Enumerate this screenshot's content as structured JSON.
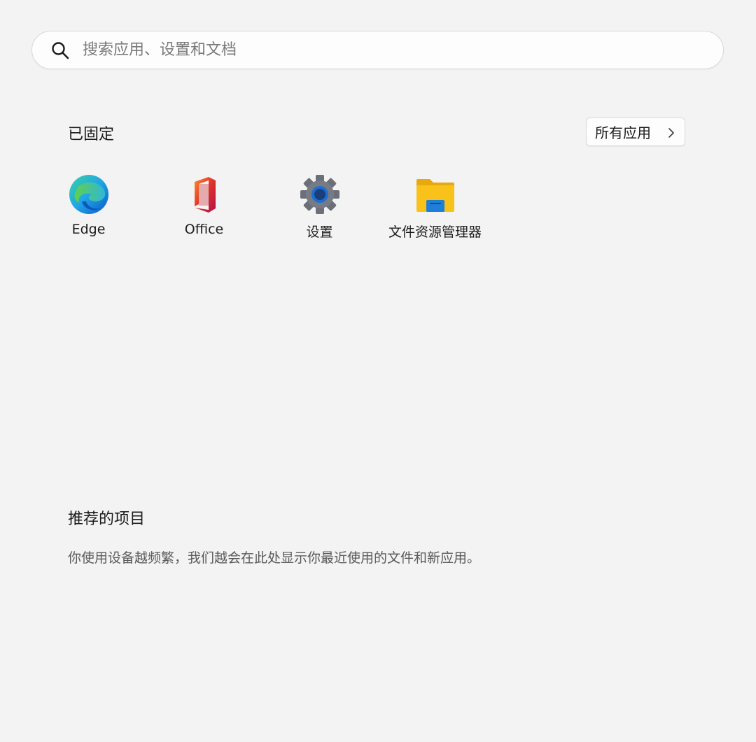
{
  "search": {
    "placeholder": "搜索应用、设置和文档",
    "value": "",
    "icon": "search-icon"
  },
  "pinned": {
    "title": "已固定",
    "all_apps_label": "所有应用",
    "apps": [
      {
        "label": "Edge",
        "icon": "edge-icon"
      },
      {
        "label": "Office",
        "icon": "office-icon"
      },
      {
        "label": "设置",
        "icon": "settings-gear-icon"
      },
      {
        "label": "文件资源管理器",
        "icon": "file-explorer-icon"
      }
    ]
  },
  "recommended": {
    "title": "推荐的项目",
    "hint": "你使用设备越频繁，我们越会在此处显示你最近使用的文件和新应用。"
  },
  "colors": {
    "background": "#f3f3f3",
    "edge_blue": "#1b8fe0",
    "edge_green": "#55c75a",
    "office_red": "#d83b01",
    "settings_gray": "#6b6f78",
    "settings_blue": "#1c6fd1",
    "folder_yellow": "#f9c21b",
    "folder_blue": "#1f7fd8"
  }
}
